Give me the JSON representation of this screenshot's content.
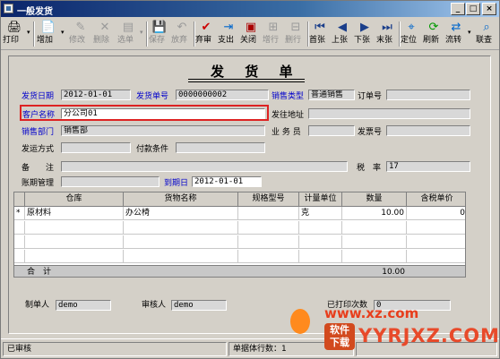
{
  "window": {
    "title": "一般发货",
    "min": "_",
    "max": "□",
    "close": "×"
  },
  "toolbar": {
    "buttons": [
      {
        "label": "打印",
        "icon": "🖨",
        "has_caret": true
      },
      {
        "label": "增加",
        "icon": "📄",
        "has_caret": true
      },
      {
        "label": "修改",
        "icon": "✎",
        "disabled": true
      },
      {
        "label": "删除",
        "icon": "✕",
        "disabled": true
      },
      {
        "label": "选单",
        "icon": "▤",
        "disabled": true,
        "has_caret": true
      },
      {
        "label": "保存",
        "icon": "💾",
        "disabled": true
      },
      {
        "label": "放弃",
        "icon": "↶",
        "disabled": true
      },
      {
        "label": "弃审",
        "icon": "✔"
      },
      {
        "label": "支出",
        "icon": "⇥"
      },
      {
        "label": "关闭",
        "icon": "▣"
      },
      {
        "label": "增行",
        "icon": "⊞",
        "disabled": true
      },
      {
        "label": "删行",
        "icon": "⊟",
        "disabled": true
      },
      {
        "label": "首张",
        "icon": "⏮"
      },
      {
        "label": "上张",
        "icon": "◀"
      },
      {
        "label": "下张",
        "icon": "▶"
      },
      {
        "label": "末张",
        "icon": "⏭"
      },
      {
        "label": "定位",
        "icon": "⌖"
      },
      {
        "label": "刷新",
        "icon": "⟳"
      },
      {
        "label": "流转",
        "icon": "⇄",
        "has_caret": true
      },
      {
        "label": "联查",
        "icon": "⌕"
      }
    ]
  },
  "form": {
    "title": "发 货 单",
    "ship_date_label": "发货日期",
    "ship_date": "2012-01-01",
    "ship_no_label": "发货单号",
    "ship_no": "0000000002",
    "sales_type_label": "销售类型",
    "sales_type": "普通销售",
    "order_no_label": "订单号",
    "order_no": "",
    "customer_label": "客户名称",
    "customer": "分公司01",
    "ship_addr_label": "发往地址",
    "ship_addr": "",
    "dept_label": "销售部门",
    "dept": "销售部",
    "salesman_label": "业 务 员",
    "salesman": "",
    "invoice_no_label": "发票号",
    "invoice_no": "",
    "ship_method_label": "发运方式",
    "ship_method": "",
    "pay_terms_label": "付款条件",
    "pay_terms": "",
    "remark_label": "备　　注",
    "remark": "",
    "tax_rate_label": "税　率",
    "tax_rate": "17",
    "period_label": "账期管理",
    "period": "",
    "due_date_label": "到期日",
    "due_date": "2012-01-01",
    "maker_label": "制单人",
    "maker": "demo",
    "auditor_label": "审核人",
    "auditor": "demo",
    "print_count_label": "已打印次数",
    "print_count": "0"
  },
  "grid": {
    "columns": [
      "仓库",
      "货物名称",
      "规格型号",
      "计量单位",
      "数量",
      "含税单价"
    ],
    "rows": [
      {
        "marker": "*",
        "warehouse": "原材料",
        "goods": "办公椅",
        "spec": "",
        "unit": "克",
        "qty": "10.00",
        "price": "0"
      }
    ],
    "total_label": "合　计",
    "total_qty": "10.00"
  },
  "status": {
    "state": "已审核",
    "row_count": "单据体行数：1"
  },
  "watermark": {
    "site": "www.xz.com",
    "brand": "YYRJXZ.COM",
    "logo_text": "软件\n下载"
  },
  "colors": {
    "title_gradient_start": "#0a246a",
    "highlight": "#dd2222",
    "blue_label": "#0000cc"
  }
}
